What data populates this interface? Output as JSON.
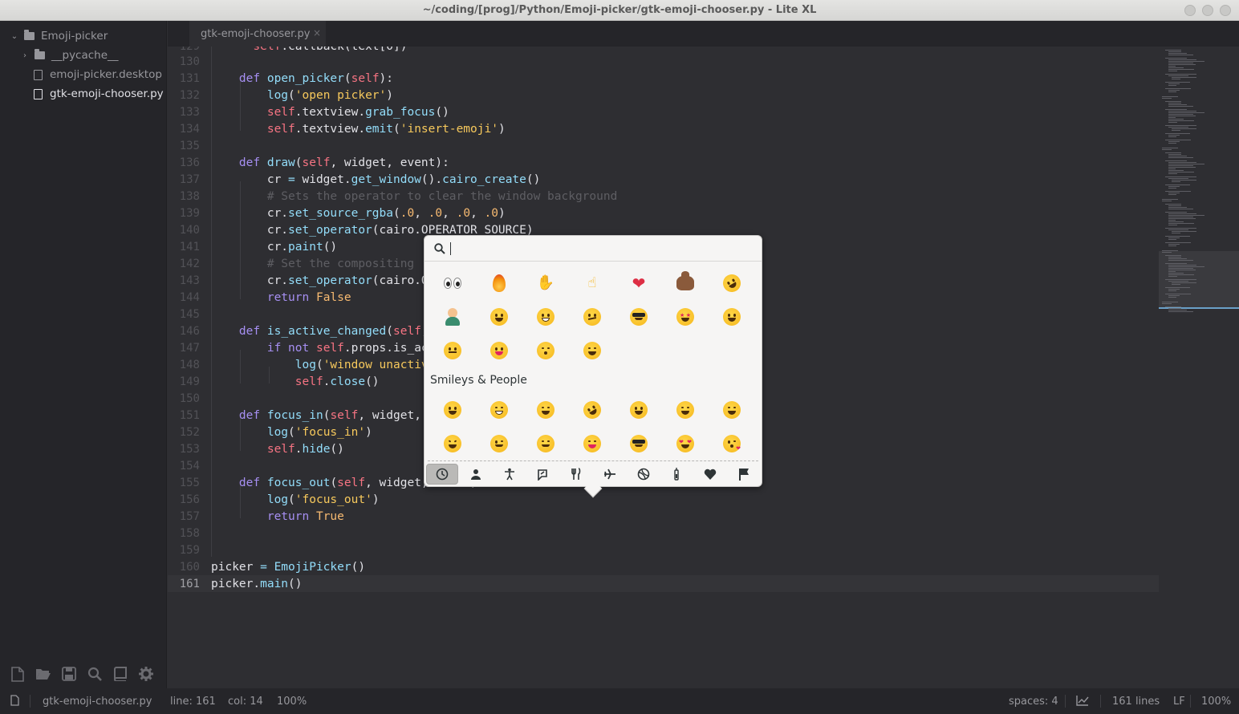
{
  "window": {
    "title": "~/coding/[prog]/Python/Emoji-picker/gtk-emoji-chooser.py - Lite XL"
  },
  "sidebar": {
    "root": {
      "label": "Emoji-picker",
      "expanded": true
    },
    "items": [
      {
        "label": "__pycache__",
        "type": "folder",
        "expanded": false
      },
      {
        "label": "emoji-picker.desktop",
        "type": "file"
      },
      {
        "label": "gtk-emoji-chooser.py",
        "type": "file",
        "active": true
      }
    ],
    "toolbar": [
      "new-file-icon",
      "open-folder-icon",
      "save-icon",
      "find-icon",
      "book-icon",
      "settings-icon"
    ]
  },
  "tabs": [
    {
      "label": "gtk-emoji-chooser.py",
      "close": "×"
    }
  ],
  "editor": {
    "current_line": 161,
    "lines": [
      {
        "n": "130",
        "indent": 1,
        "code": ""
      },
      {
        "n": "131",
        "indent": 1,
        "code": "def open_picker(self):"
      },
      {
        "n": "132",
        "indent": 2,
        "code": "log('open picker')"
      },
      {
        "n": "133",
        "indent": 2,
        "code": "self.textview.grab_focus()"
      },
      {
        "n": "134",
        "indent": 2,
        "code": "self.textview.emit('insert-emoji')"
      },
      {
        "n": "135",
        "indent": 1,
        "code": ""
      },
      {
        "n": "136",
        "indent": 1,
        "code": "def draw(self, widget, event):"
      },
      {
        "n": "137",
        "indent": 2,
        "code": "cr = widget.get_window().cairo_create()"
      },
      {
        "n": "138",
        "indent": 2,
        "code": "# Sets the operator to clear the window background"
      },
      {
        "n": "139",
        "indent": 2,
        "code": "cr.set_source_rgba(.0, .0, .0, .0)"
      },
      {
        "n": "140",
        "indent": 2,
        "code": "cr.set_operator(cairo.OPERATOR_SOURCE)"
      },
      {
        "n": "141",
        "indent": 2,
        "code": "cr.paint()"
      },
      {
        "n": "142",
        "indent": 2,
        "code": "# Set the compositing"
      },
      {
        "n": "143",
        "indent": 2,
        "code": "cr.set_operator(cairo.OPERATOR_OVER)"
      },
      {
        "n": "144",
        "indent": 2,
        "code": "return False"
      },
      {
        "n": "145",
        "indent": 1,
        "code": ""
      },
      {
        "n": "146",
        "indent": 1,
        "code": "def is_active_changed(self, widget, event):"
      },
      {
        "n": "147",
        "indent": 2,
        "code": "if not self.props.is_active:"
      },
      {
        "n": "148",
        "indent": 3,
        "code": "log('window unactive, closing...')"
      },
      {
        "n": "149",
        "indent": 3,
        "code": "self.close()"
      },
      {
        "n": "150",
        "indent": 1,
        "code": ""
      },
      {
        "n": "151",
        "indent": 1,
        "code": "def focus_in(self, widget, event):"
      },
      {
        "n": "152",
        "indent": 2,
        "code": "log('focus_in')"
      },
      {
        "n": "153",
        "indent": 2,
        "code": "self.hide()"
      },
      {
        "n": "154",
        "indent": 1,
        "code": ""
      },
      {
        "n": "155",
        "indent": 1,
        "code": "def focus_out(self, widget, event):"
      },
      {
        "n": "156",
        "indent": 2,
        "code": "log('focus_out')"
      },
      {
        "n": "157",
        "indent": 2,
        "code": "return True"
      },
      {
        "n": "158",
        "indent": 1,
        "code": ""
      },
      {
        "n": "159",
        "indent": 1,
        "code": ""
      },
      {
        "n": "160",
        "indent": 0,
        "code": "picker = EmojiPicker()"
      },
      {
        "n": "161",
        "indent": 0,
        "code": "picker.main()"
      }
    ]
  },
  "emoji_chooser": {
    "search": {
      "value": "",
      "icon": "search-icon"
    },
    "recent": [
      "eyes",
      "fire",
      "ok-hand",
      "point-up",
      "red-heart",
      "pile-of-poo",
      "rolling-on-floor-laughing",
      "man-facepalming",
      "face-with-tears-of-joy",
      "beaming-face",
      "confused-face",
      "smiling-face-with-sunglasses",
      "star-struck",
      "grinning-face-big-eyes",
      "lying-face",
      "face-savoring-food",
      "kissing-face-closed-eyes",
      "grinning-face-smiling-eyes"
    ],
    "section_label": "Smileys & People",
    "section_emojis": [
      "grinning-face",
      "beaming-face",
      "face-with-tears-of-joy",
      "rolling-on-floor-laughing",
      "grinning-face-big-eyes",
      "grinning-face-smiling-eyes",
      "grinning-face-sweat",
      "grinning-squinting-face",
      "winking-face",
      "smiling-face-smiling-eyes",
      "face-savoring-food",
      "smiling-face-with-sunglasses",
      "heart-eyes",
      "face-blowing-kiss"
    ],
    "categories": [
      {
        "icon": "recent-clock-icon",
        "active": true
      },
      {
        "icon": "smileys-people-icon"
      },
      {
        "icon": "body-activity-icon"
      },
      {
        "icon": "animals-nature-icon"
      },
      {
        "icon": "food-drink-icon"
      },
      {
        "icon": "travel-places-icon"
      },
      {
        "icon": "activities-icon"
      },
      {
        "icon": "objects-icon"
      },
      {
        "icon": "symbols-icon"
      },
      {
        "icon": "flags-icon"
      }
    ]
  },
  "statusbar": {
    "filename": "gtk-emoji-chooser.py",
    "line": "line: 161",
    "col": "col: 14",
    "zoom": "100%",
    "spaces": "spaces: 4",
    "lines": "161 lines",
    "eol": "LF",
    "zoom_right": "100%"
  },
  "colors": {
    "background": "#2e2e32",
    "sidebar": "#252529",
    "keyword": "#a68ff2",
    "function": "#93ddfa",
    "string": "#f7c95c",
    "comment": "#5e5e63",
    "literal": "#f7ba71"
  }
}
